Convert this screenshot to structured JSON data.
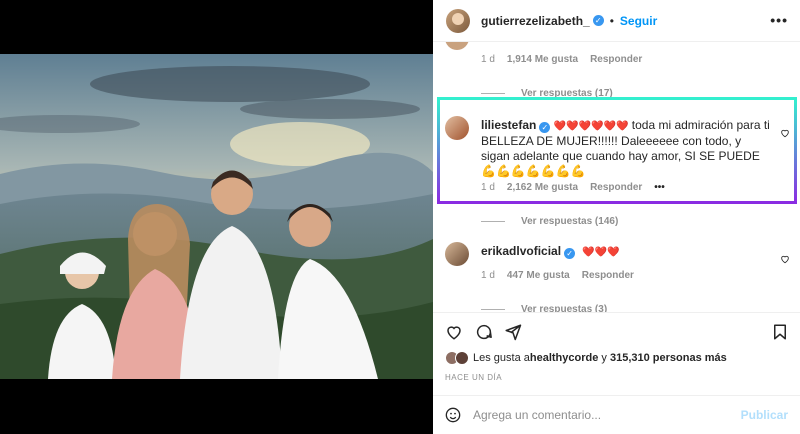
{
  "post": {
    "author": "gutierrezelizabeth_",
    "follow_label": "Seguir",
    "separator": "•",
    "more": "•••"
  },
  "comments": [
    {
      "meta": {
        "time": "1 d",
        "likes": "1,914 Me gusta",
        "reply": "Responder"
      },
      "view_replies": "Ver respuestas (17)"
    },
    {
      "user": "liliestefan",
      "hearts": "❤️❤️❤️❤️❤️❤️",
      "text": " toda mi admiración para ti BELLEZA DE MUJER!!!!!! Daleeeeee con todo, y sigan adelante que cuando hay amor, SI SE PUEDE 💪💪💪💪💪💪💪",
      "meta": {
        "time": "1 d",
        "likes": "2,162 Me gusta",
        "reply": "Responder",
        "more": "•••"
      },
      "view_replies": "Ver respuestas (146)"
    },
    {
      "user": "erikadlvoficial",
      "hearts": "❤️❤️❤️",
      "meta": {
        "time": "1 d",
        "likes": "447 Me gusta",
        "reply": "Responder"
      },
      "view_replies": "Ver respuestas (3)"
    }
  ],
  "likes": {
    "prefix": "Les gusta a ",
    "user": "healthycorde",
    "middle": " y ",
    "count": "315,310 personas más"
  },
  "time_ago": "HACE UN DÍA",
  "add_comment": {
    "placeholder": "Agrega un comentario...",
    "publish": "Publicar"
  },
  "colors": {
    "accent": "#0095f6",
    "highlight_top": "#33f0cf",
    "highlight_bottom": "#8a2be2"
  }
}
